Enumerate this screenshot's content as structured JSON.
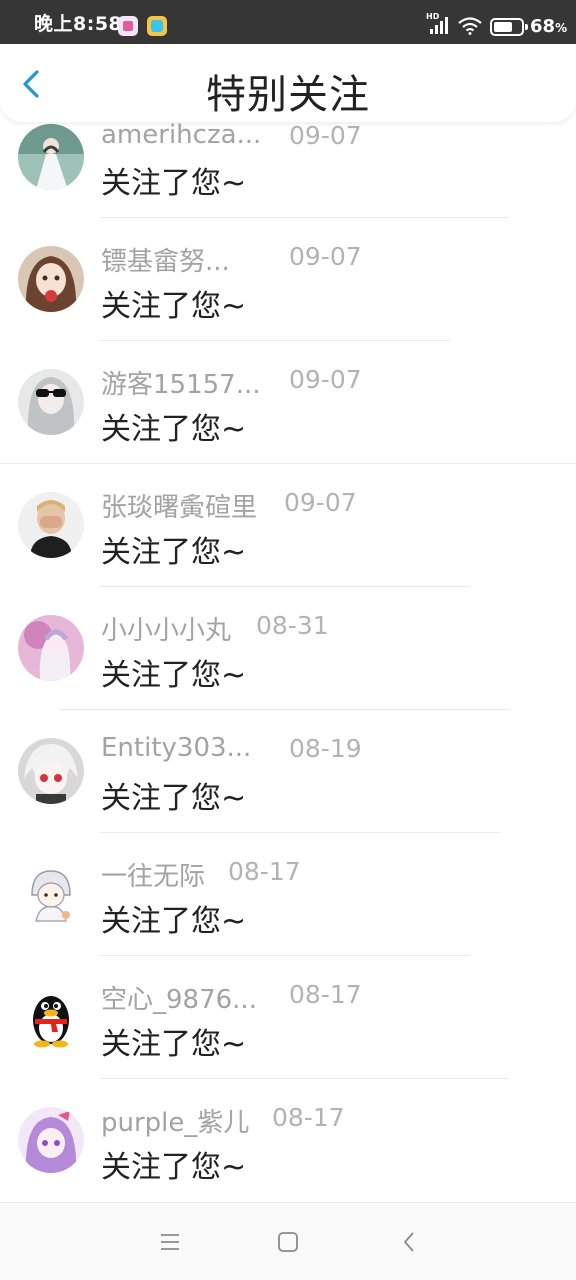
{
  "status_bar": {
    "time": "晚上8:58",
    "hd": "HD",
    "battery_percent": "68",
    "battery_unit": "%",
    "battery_level": 0.68
  },
  "header": {
    "title": "特别关注",
    "back_icon": "chevron-left-icon"
  },
  "follows": [
    {
      "name": "amerihcza...",
      "date": "09-07",
      "message": "关注了您~",
      "avatar": "avatar-bride"
    },
    {
      "name": "镖基畲努...",
      "date": "09-07",
      "message": "关注了您~",
      "avatar": "avatar-girl-strawberry"
    },
    {
      "name": "游客15157...",
      "date": "09-07",
      "message": "关注了您~",
      "avatar": "avatar-sunglasses"
    },
    {
      "name": "张琰曙夤碹里",
      "date": "09-07",
      "message": "关注了您~",
      "avatar": "avatar-boy-hands"
    },
    {
      "name": "小小小小丸",
      "date": "08-31",
      "message": "关注了您~",
      "avatar": "avatar-anime-pink"
    },
    {
      "name": "Entity303...",
      "date": "08-19",
      "message": "关注了您~",
      "avatar": "avatar-anime-white"
    },
    {
      "name": "一往无际",
      "date": "08-17",
      "message": "关注了您~",
      "avatar": "avatar-chibi-sketch"
    },
    {
      "name": "空心_9876...",
      "date": "08-17",
      "message": "关注了您~",
      "avatar": "avatar-qq-penguin"
    },
    {
      "name": "purple_紫儿",
      "date": "08-17",
      "message": "关注了您~",
      "avatar": "avatar-anime-purple"
    }
  ],
  "nav_bar": {
    "menu_icon": "menu-icon",
    "home_icon": "home-square-icon",
    "back_icon": "back-chevron-icon"
  },
  "colors": {
    "accent": "#2196d3",
    "status_bar_bg": "#363636",
    "name_text": "#a3a3a3",
    "message_text": "#222222"
  }
}
